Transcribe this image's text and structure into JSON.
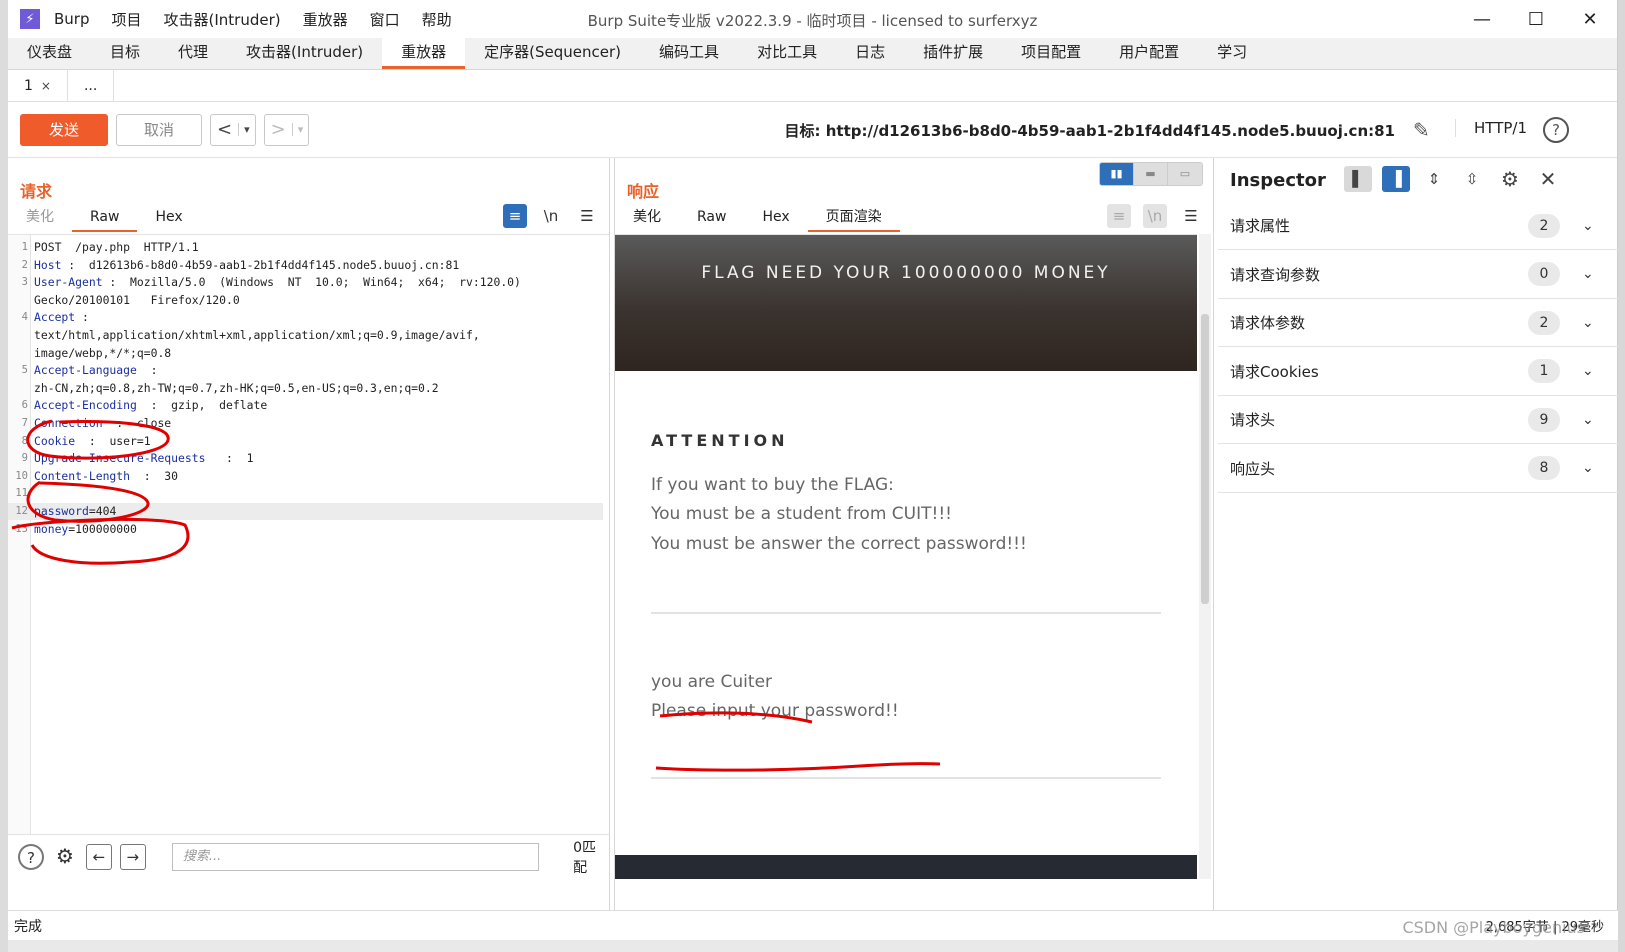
{
  "titlebar": {
    "logo_glyph": "⚡",
    "menu": [
      "Burp",
      "项目",
      "攻击器(Intruder)",
      "重放器",
      "窗口",
      "帮助"
    ],
    "title": "Burp Suite专业版  v2022.3.9 - 临时项目 - licensed to surferxyz",
    "minimize": "—",
    "maximize": "☐",
    "close": "✕"
  },
  "main_tabs": [
    "仪表盘",
    "目标",
    "代理",
    "攻击器(Intruder)",
    "重放器",
    "定序器(Sequencer)",
    "编码工具",
    "对比工具",
    "日志",
    "插件扩展",
    "项目配置",
    "用户配置",
    "学习"
  ],
  "main_tabs_active": "重放器",
  "sub_tabs": {
    "tab1": "1",
    "tab1_close": "×",
    "more": "..."
  },
  "toolbar": {
    "send": "发送",
    "cancel": "取消",
    "back": "<",
    "forward": ">",
    "dropdown": "▾",
    "target": "目标: http://d12613b6-b8d0-4b59-aab1-2b1f4dd4f145.node5.buuoj.cn:81",
    "http_version": "HTTP/1"
  },
  "request": {
    "title": "请求",
    "tabs": [
      "美化",
      "Raw",
      "Hex"
    ],
    "active_tab": "Raw",
    "lines": [
      {
        "n": "1",
        "key": "",
        "val": "POST  /pay.php  HTTP/1.1"
      },
      {
        "n": "2",
        "key": "Host",
        "val": " :  d12613b6-b8d0-4b59-aab1-2b1f4dd4f145.node5.buuoj.cn:81"
      },
      {
        "n": "3",
        "key": "User-Agent",
        "val": " :  Mozilla/5.0  (Windows  NT  10.0;  Win64;  x64;  rv:120.0)"
      },
      {
        "n": "",
        "key": "",
        "val": "Gecko/20100101   Firefox/120.0"
      },
      {
        "n": "4",
        "key": "Accept",
        "val": " :"
      },
      {
        "n": "",
        "key": "",
        "val": "text/html,application/xhtml+xml,application/xml;q=0.9,image/avif,"
      },
      {
        "n": "",
        "key": "",
        "val": "image/webp,*/*;q=0.8"
      },
      {
        "n": "5",
        "key": "Accept-Language",
        "val": "  :"
      },
      {
        "n": "",
        "key": "",
        "val": "zh-CN,zh;q=0.8,zh-TW;q=0.7,zh-HK;q=0.5,en-US;q=0.3,en;q=0.2"
      },
      {
        "n": "6",
        "key": "Accept-Encoding",
        "val": "  :  gzip,  deflate"
      },
      {
        "n": "7",
        "key": "Connection",
        "val": "  :  close"
      },
      {
        "n": "8",
        "key": "Cookie",
        "val": "  :  user=1"
      },
      {
        "n": "9",
        "key": "Upgrade-Insecure-Requests",
        "val": "   :  1"
      },
      {
        "n": "10",
        "key": "Content-Length",
        "val": "  :  30"
      },
      {
        "n": "11",
        "key": "",
        "val": ""
      },
      {
        "n": "12",
        "key": "password",
        "val": "=404"
      },
      {
        "n": "13",
        "key": "money",
        "val": "=100000000"
      }
    ],
    "search_placeholder": "搜索...",
    "match_count": "0匹配"
  },
  "response": {
    "title": "响应",
    "tabs": [
      "美化",
      "Raw",
      "Hex",
      "页面渲染"
    ],
    "active_tab": "页面渲染",
    "hero_text": "FLAG NEED YOUR 100000000 MONEY",
    "attention": "ATTENTION",
    "body_lines": [
      "If you want to buy the FLAG:",
      "You must be a student from CUIT!!!",
      "You must be answer the correct password!!!"
    ],
    "result_lines": [
      "you are Cuiter",
      "Please input your password!!"
    ]
  },
  "inspector": {
    "title": "Inspector",
    "rows": [
      {
        "label": "请求属性",
        "count": "2"
      },
      {
        "label": "请求查询参数",
        "count": "0"
      },
      {
        "label": "请求体参数",
        "count": "2"
      },
      {
        "label": "请求Cookies",
        "count": "1"
      },
      {
        "label": "请求头",
        "count": "9"
      },
      {
        "label": "响应头",
        "count": "8"
      }
    ]
  },
  "status": {
    "left": "完成",
    "right": "2,685字节 | 29毫秒"
  },
  "watermark": "CSDN @Playboygenius",
  "colors": {
    "accent": "#e8622c",
    "send_button": "#ef5b2a",
    "toggle_blue": "#2f6fba",
    "annotation_red": "#e00000"
  }
}
